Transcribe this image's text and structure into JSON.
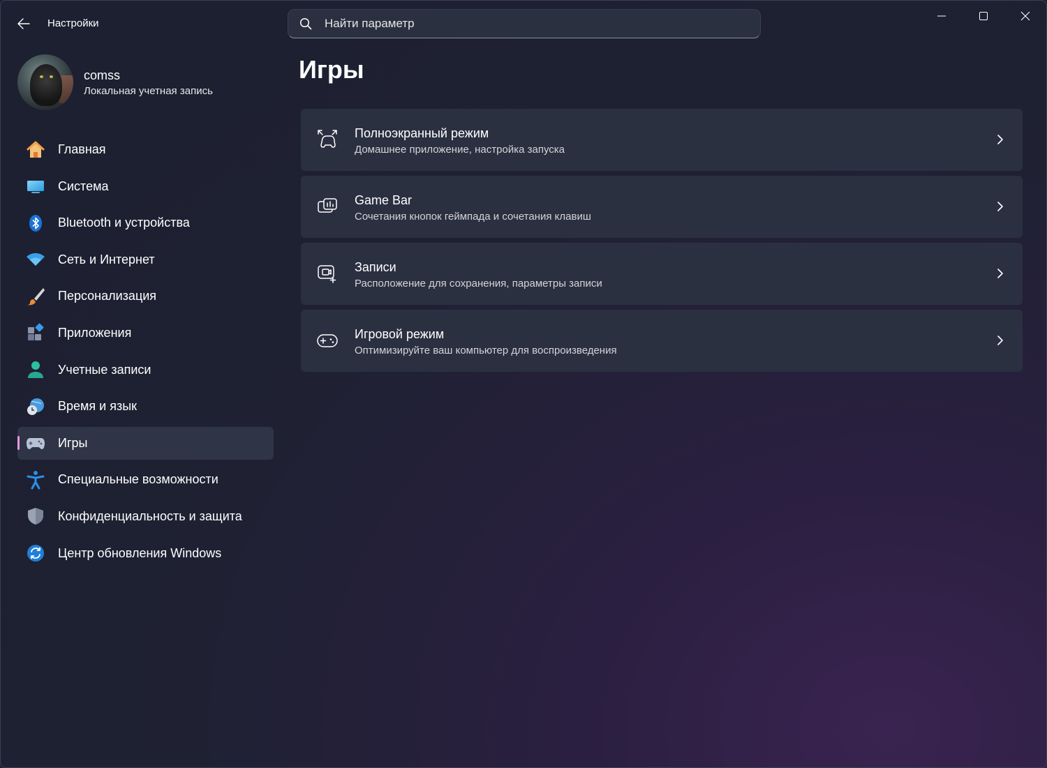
{
  "app": {
    "title": "Настройки"
  },
  "search": {
    "placeholder": "Найти параметр"
  },
  "user": {
    "name": "comss",
    "account_type": "Локальная учетная запись"
  },
  "sidebar": {
    "items": [
      {
        "label": "Главная",
        "icon": "home-icon"
      },
      {
        "label": "Система",
        "icon": "system-icon"
      },
      {
        "label": "Bluetooth и устройства",
        "icon": "bluetooth-icon"
      },
      {
        "label": "Сеть и Интернет",
        "icon": "wifi-icon"
      },
      {
        "label": "Персонализация",
        "icon": "brush-icon"
      },
      {
        "label": "Приложения",
        "icon": "apps-icon"
      },
      {
        "label": "Учетные записи",
        "icon": "accounts-icon"
      },
      {
        "label": "Время и язык",
        "icon": "time-language-icon"
      },
      {
        "label": "Игры",
        "icon": "gamepad-icon",
        "active": true
      },
      {
        "label": "Специальные возможности",
        "icon": "accessibility-icon"
      },
      {
        "label": "Конфиденциальность и защита",
        "icon": "shield-icon"
      },
      {
        "label": "Центр обновления Windows",
        "icon": "windows-update-icon"
      }
    ]
  },
  "main": {
    "title": "Игры",
    "cards": [
      {
        "title": "Полноэкранный режим",
        "subtitle": "Домашнее приложение, настройка запуска",
        "icon": "fullscreen-game-icon"
      },
      {
        "title": "Game Bar",
        "subtitle": "Сочетания кнопок геймпада и сочетания клавиш",
        "icon": "game-bar-icon"
      },
      {
        "title": "Записи",
        "subtitle": "Расположение для сохранения, параметры записи",
        "icon": "captures-icon"
      },
      {
        "title": "Игровой режим",
        "subtitle": "Оптимизируйте ваш компьютер для воспроизведения",
        "icon": "game-mode-icon"
      }
    ]
  },
  "colors": {
    "accent": "#e29bdd",
    "card_bg": "#2b3041"
  }
}
